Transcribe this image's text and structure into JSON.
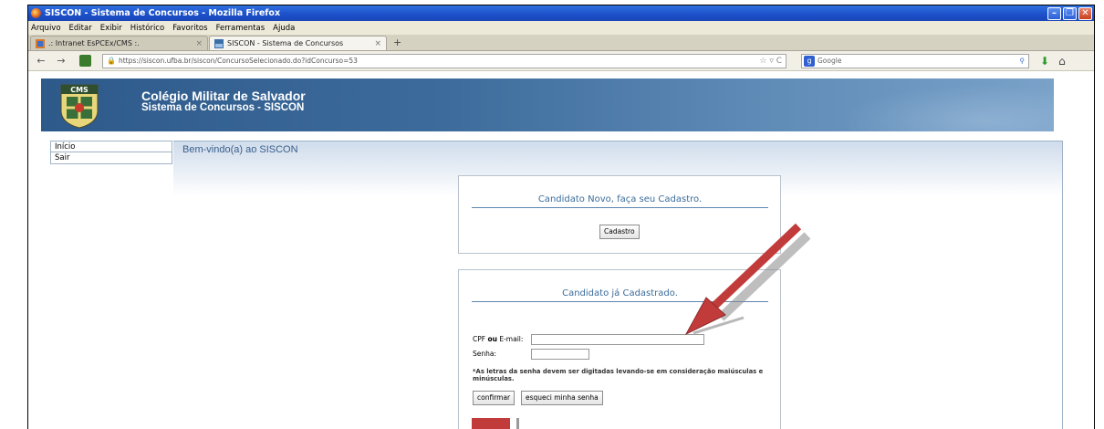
{
  "window": {
    "title": "SISCON - Sistema de Concursos - Mozilla Firefox"
  },
  "menu": [
    "Arquivo",
    "Editar",
    "Exibir",
    "Histórico",
    "Favoritos",
    "Ferramentas",
    "Ajuda"
  ],
  "tabs": [
    {
      "label": ".: Intranet EsPCEx/CMS :."
    },
    {
      "label": "SISCON - Sistema de Concursos"
    }
  ],
  "nav": {
    "url": "https://siscon.ufba.br/siscon/ConcursoSelecionado.do?idConcurso=53",
    "search_placeholder": "Google"
  },
  "site": {
    "logo_text": "CMS",
    "title": "Colégio Militar de Salvador",
    "subtitle": "Sistema de Concursos - SISCON"
  },
  "sidebar": {
    "items": [
      {
        "label": "Início"
      },
      {
        "label": "Sair"
      }
    ]
  },
  "content": {
    "welcome": "Bem-vindo(a) ao SISCON",
    "new_candidate": {
      "title": "Candidato Novo, faça seu Cadastro.",
      "button": "Cadastro"
    },
    "existing_candidate": {
      "title": "Candidato já Cadastrado.",
      "cpf_label_1": "CPF ",
      "cpf_label_bold": "ou",
      "cpf_label_2": " E-mail:",
      "password_label": "Senha:",
      "note": "*As letras da senha devem ser digitadas levando-se em consideração maiúsculas e minúsculas.",
      "confirm_button": "confirmar",
      "forgot_button": "esqueci minha senha"
    }
  },
  "colors": {
    "banner": "#3d6b9b",
    "arrow": "#c23b3b"
  }
}
